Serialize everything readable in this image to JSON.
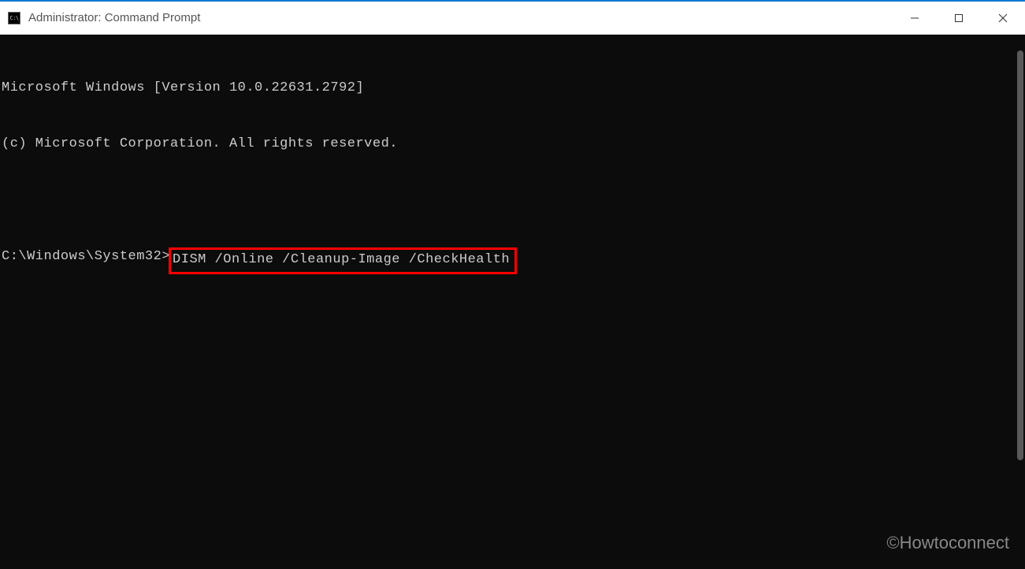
{
  "titlebar": {
    "icon_text": "C:\\",
    "title": "Administrator: Command Prompt"
  },
  "terminal": {
    "line1": "Microsoft Windows [Version 10.0.22631.2792]",
    "line2": "(c) Microsoft Corporation. All rights reserved.",
    "prompt": "C:\\Windows\\System32>",
    "command": "DISM /Online /Cleanup-Image /CheckHealth"
  },
  "watermark": "©Howtoconnect"
}
